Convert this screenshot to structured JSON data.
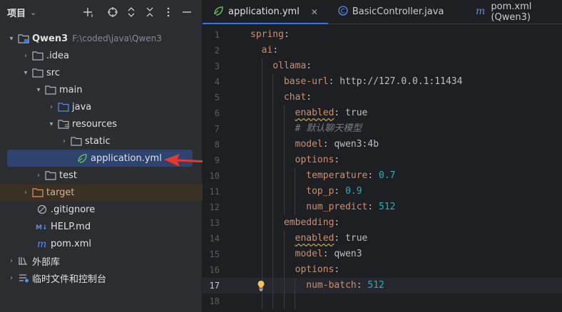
{
  "project_panel": {
    "title": "项目",
    "tree": [
      {
        "label": "Qwen3",
        "path": "F:\\coded\\java\\Qwen3"
      },
      {
        "label": ".idea"
      },
      {
        "label": "src"
      },
      {
        "label": "main"
      },
      {
        "label": "java"
      },
      {
        "label": "resources"
      },
      {
        "label": "static"
      },
      {
        "label": "application.yml"
      },
      {
        "label": "test"
      },
      {
        "label": "target"
      },
      {
        "label": ".gitignore"
      },
      {
        "label": "HELP.md"
      },
      {
        "label": "pom.xml"
      },
      {
        "label": "外部库"
      },
      {
        "label": "临时文件和控制台"
      }
    ]
  },
  "tabs": [
    {
      "label": "application.yml",
      "active": true
    },
    {
      "label": "BasicController.java"
    },
    {
      "label": "pom.xml (Qwen3)"
    }
  ],
  "editor": {
    "current_line": 17,
    "lines": [
      {
        "n": "1",
        "parts": [
          [
            "k",
            "spring"
          ],
          [
            "v",
            ":"
          ]
        ]
      },
      {
        "n": "2",
        "parts": [
          [
            "v",
            "  "
          ],
          [
            "k",
            "ai"
          ],
          [
            "v",
            ":"
          ]
        ]
      },
      {
        "n": "3",
        "parts": [
          [
            "v",
            "    "
          ],
          [
            "k",
            "ollama"
          ],
          [
            "v",
            ":"
          ]
        ]
      },
      {
        "n": "4",
        "parts": [
          [
            "v",
            "      "
          ],
          [
            "k",
            "base-url"
          ],
          [
            "v",
            ": http://127.0.0.1:11434"
          ]
        ]
      },
      {
        "n": "5",
        "parts": [
          [
            "v",
            "      "
          ],
          [
            "k",
            "chat"
          ],
          [
            "v",
            ":"
          ]
        ]
      },
      {
        "n": "6",
        "parts": [
          [
            "v",
            "        "
          ],
          [
            "kw",
            "enabled"
          ],
          [
            "v",
            ": true"
          ]
        ]
      },
      {
        "n": "7",
        "parts": [
          [
            "v",
            "        "
          ],
          [
            "c",
            "# 默认聊天模型"
          ]
        ]
      },
      {
        "n": "8",
        "parts": [
          [
            "v",
            "        "
          ],
          [
            "k",
            "model"
          ],
          [
            "v",
            ": qwen3:4b"
          ]
        ]
      },
      {
        "n": "9",
        "parts": [
          [
            "v",
            "        "
          ],
          [
            "k",
            "options"
          ],
          [
            "v",
            ":"
          ]
        ]
      },
      {
        "n": "10",
        "parts": [
          [
            "v",
            "          "
          ],
          [
            "k",
            "temperature"
          ],
          [
            "v",
            ": "
          ],
          [
            "n",
            "0.7"
          ]
        ]
      },
      {
        "n": "11",
        "parts": [
          [
            "v",
            "          "
          ],
          [
            "k",
            "top_p"
          ],
          [
            "v",
            ": "
          ],
          [
            "n",
            "0.9"
          ]
        ]
      },
      {
        "n": "12",
        "parts": [
          [
            "v",
            "          "
          ],
          [
            "k",
            "num_predict"
          ],
          [
            "v",
            ": "
          ],
          [
            "n",
            "512"
          ]
        ]
      },
      {
        "n": "13",
        "parts": [
          [
            "v",
            "      "
          ],
          [
            "k",
            "embedding"
          ],
          [
            "v",
            ":"
          ]
        ]
      },
      {
        "n": "14",
        "parts": [
          [
            "v",
            "        "
          ],
          [
            "kw",
            "enabled"
          ],
          [
            "v",
            ": true"
          ]
        ]
      },
      {
        "n": "15",
        "parts": [
          [
            "v",
            "        "
          ],
          [
            "k",
            "model"
          ],
          [
            "v",
            ": qwen3"
          ]
        ]
      },
      {
        "n": "16",
        "parts": [
          [
            "v",
            "        "
          ],
          [
            "k",
            "options"
          ],
          [
            "v",
            ":"
          ]
        ]
      },
      {
        "n": "17",
        "parts": [
          [
            "v",
            "          "
          ],
          [
            "k",
            "num-batch"
          ],
          [
            "v",
            ": "
          ],
          [
            "n",
            "512"
          ]
        ]
      },
      {
        "n": "18",
        "parts": []
      }
    ]
  },
  "colors": {
    "accent": "#3574f0",
    "key": "#cf8e6d",
    "number": "#2aacb8",
    "arrow": "#e53935"
  }
}
